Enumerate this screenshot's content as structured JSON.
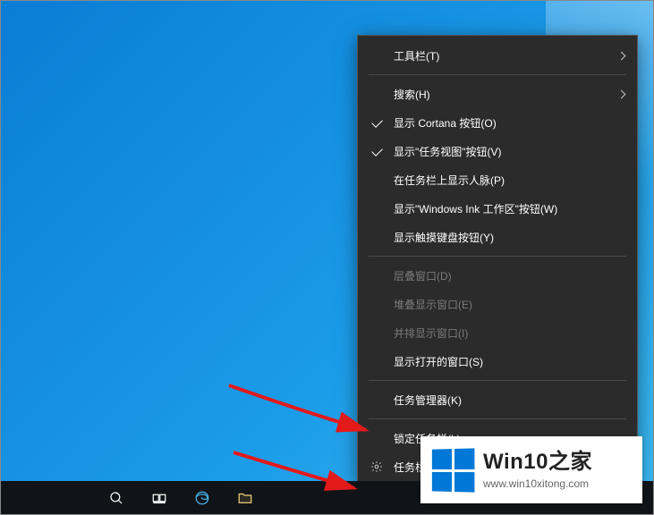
{
  "menu": {
    "toolbars": {
      "label": "工具栏(T)",
      "checked": false,
      "submenu": true,
      "disabled": false
    },
    "search": {
      "label": "搜索(H)",
      "checked": false,
      "submenu": true,
      "disabled": false
    },
    "cortana": {
      "label": "显示 Cortana 按钮(O)",
      "checked": true,
      "submenu": false,
      "disabled": false
    },
    "taskview": {
      "label": "显示\"任务视图\"按钮(V)",
      "checked": true,
      "submenu": false,
      "disabled": false
    },
    "people": {
      "label": "在任务栏上显示人脉(P)",
      "checked": false,
      "submenu": false,
      "disabled": false
    },
    "ink": {
      "label": "显示\"Windows Ink 工作区\"按钮(W)",
      "checked": false,
      "submenu": false,
      "disabled": false
    },
    "touchkb": {
      "label": "显示触摸键盘按钮(Y)",
      "checked": false,
      "submenu": false,
      "disabled": false
    },
    "cascade": {
      "label": "层叠窗口(D)",
      "checked": false,
      "submenu": false,
      "disabled": true
    },
    "stacked": {
      "label": "堆叠显示窗口(E)",
      "checked": false,
      "submenu": false,
      "disabled": true
    },
    "sidebyside": {
      "label": "并排显示窗口(I)",
      "checked": false,
      "submenu": false,
      "disabled": true
    },
    "showopen": {
      "label": "显示打开的窗口(S)",
      "checked": false,
      "submenu": false,
      "disabled": false
    },
    "taskmgr": {
      "label": "任务管理器(K)",
      "checked": false,
      "submenu": false,
      "disabled": false
    },
    "lock": {
      "label": "锁定任务栏(L)",
      "checked": false,
      "submenu": false,
      "disabled": false
    },
    "settings": {
      "label": "任务栏设置(T)",
      "checked": false,
      "submenu": false,
      "disabled": false,
      "icon": "gear"
    }
  },
  "taskbar": {
    "search_icon": "search-icon",
    "taskview_icon": "task-view-icon",
    "app1_icon": "edge-icon",
    "app2_icon": "file-explorer-icon"
  },
  "watermark": {
    "title": "Win10之家",
    "url": "www.win10xitong.com"
  }
}
